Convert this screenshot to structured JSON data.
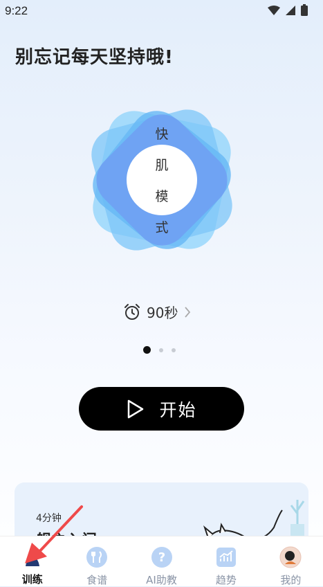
{
  "status_bar": {
    "time": "9:22"
  },
  "headline": "别忘记每天坚持哦!",
  "mode": {
    "chars": [
      "快",
      "肌",
      "模",
      "式"
    ]
  },
  "timer": {
    "value": "90秒"
  },
  "carousel": {
    "page_count": 3,
    "active_index": 0
  },
  "start_button": {
    "label": "开始"
  },
  "card": {
    "duration": "4分钟",
    "title": "舰之入门"
  },
  "tabs": [
    {
      "label": "训练",
      "icon": "trainer-icon",
      "active": true
    },
    {
      "label": "食谱",
      "icon": "fork-knife-icon",
      "active": false
    },
    {
      "label": "AI助教",
      "icon": "question-icon",
      "active": false
    },
    {
      "label": "趋势",
      "icon": "chart-icon",
      "active": false
    },
    {
      "label": "我的",
      "icon": "avatar-icon",
      "active": false
    }
  ],
  "colors": {
    "petal_light": "#8ed3fb",
    "petal_mid": "#67b8f5",
    "petal_deep": "#6f9cf2",
    "accent_blue": "#5aa5f0",
    "button": "#000000",
    "annotation_arrow": "#ef4a4a"
  }
}
